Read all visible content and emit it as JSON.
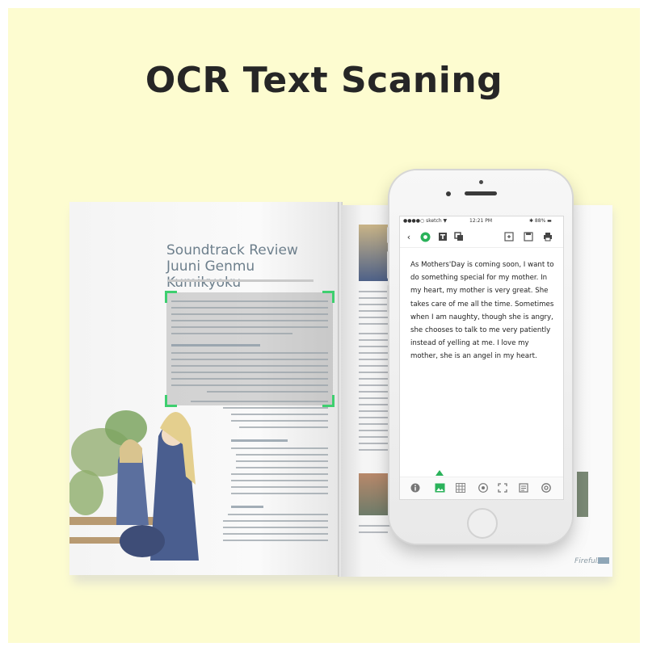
{
  "title": "OCR Text Scaning",
  "book": {
    "heading_line1": "Soundtrack Review",
    "heading_line2": "Juuni Genmu Kumikyoku",
    "brand": "Firefuls"
  },
  "phone": {
    "status": {
      "carrier": "●●●●○ sketch ▼",
      "time": "12:21 PM",
      "battery": "✱ 88% ▬"
    },
    "ocr_text": "As Mothers'Day is coming soon, I want to do something special for my mother. In my heart, my mother is very great. She takes care of me all the time. Sometimes when I am naughty, though she is angry, she chooses to talk to me very patiently instead of yelling at me. I love my mother, she is an angel in my heart.",
    "toolbar_icons": [
      "back-icon",
      "ocr-icon",
      "text-icon",
      "copy-icon",
      "export-icon",
      "save-icon",
      "print-icon"
    ],
    "bottom_icons": [
      "info-icon",
      "image-icon",
      "table-icon",
      "globe-icon",
      "crop-icon",
      "document-icon",
      "settings-icon"
    ],
    "accent": "#2ab25a"
  },
  "scan_corner_color": "#3ecf6f",
  "background": "#fdfcd0"
}
